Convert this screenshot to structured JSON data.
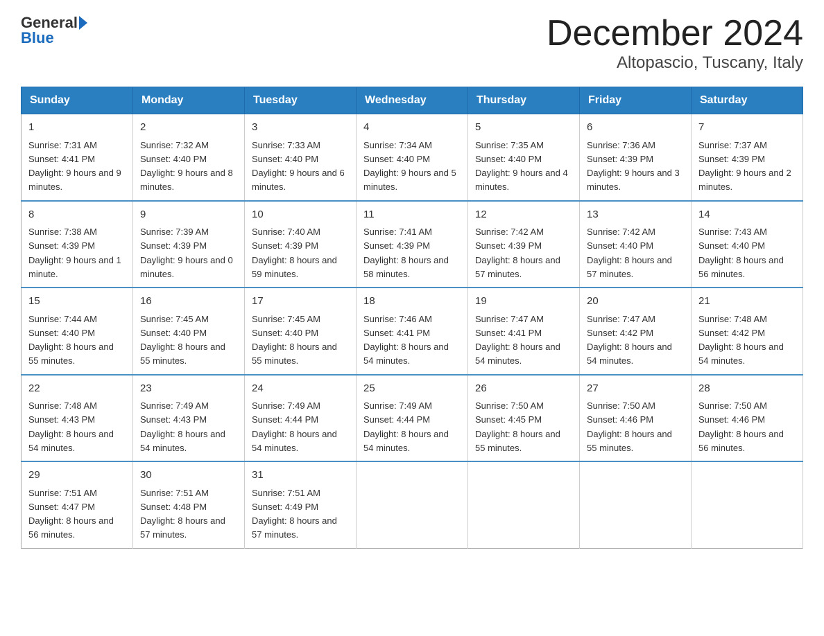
{
  "header": {
    "logo_general": "General",
    "logo_blue": "Blue",
    "month_title": "December 2024",
    "location": "Altopascio, Tuscany, Italy"
  },
  "days_of_week": [
    "Sunday",
    "Monday",
    "Tuesday",
    "Wednesday",
    "Thursday",
    "Friday",
    "Saturday"
  ],
  "weeks": [
    [
      {
        "day": "1",
        "sunrise": "7:31 AM",
        "sunset": "4:41 PM",
        "daylight": "9 hours and 9 minutes."
      },
      {
        "day": "2",
        "sunrise": "7:32 AM",
        "sunset": "4:40 PM",
        "daylight": "9 hours and 8 minutes."
      },
      {
        "day": "3",
        "sunrise": "7:33 AM",
        "sunset": "4:40 PM",
        "daylight": "9 hours and 6 minutes."
      },
      {
        "day": "4",
        "sunrise": "7:34 AM",
        "sunset": "4:40 PM",
        "daylight": "9 hours and 5 minutes."
      },
      {
        "day": "5",
        "sunrise": "7:35 AM",
        "sunset": "4:40 PM",
        "daylight": "9 hours and 4 minutes."
      },
      {
        "day": "6",
        "sunrise": "7:36 AM",
        "sunset": "4:39 PM",
        "daylight": "9 hours and 3 minutes."
      },
      {
        "day": "7",
        "sunrise": "7:37 AM",
        "sunset": "4:39 PM",
        "daylight": "9 hours and 2 minutes."
      }
    ],
    [
      {
        "day": "8",
        "sunrise": "7:38 AM",
        "sunset": "4:39 PM",
        "daylight": "9 hours and 1 minute."
      },
      {
        "day": "9",
        "sunrise": "7:39 AM",
        "sunset": "4:39 PM",
        "daylight": "9 hours and 0 minutes."
      },
      {
        "day": "10",
        "sunrise": "7:40 AM",
        "sunset": "4:39 PM",
        "daylight": "8 hours and 59 minutes."
      },
      {
        "day": "11",
        "sunrise": "7:41 AM",
        "sunset": "4:39 PM",
        "daylight": "8 hours and 58 minutes."
      },
      {
        "day": "12",
        "sunrise": "7:42 AM",
        "sunset": "4:39 PM",
        "daylight": "8 hours and 57 minutes."
      },
      {
        "day": "13",
        "sunrise": "7:42 AM",
        "sunset": "4:40 PM",
        "daylight": "8 hours and 57 minutes."
      },
      {
        "day": "14",
        "sunrise": "7:43 AM",
        "sunset": "4:40 PM",
        "daylight": "8 hours and 56 minutes."
      }
    ],
    [
      {
        "day": "15",
        "sunrise": "7:44 AM",
        "sunset": "4:40 PM",
        "daylight": "8 hours and 55 minutes."
      },
      {
        "day": "16",
        "sunrise": "7:45 AM",
        "sunset": "4:40 PM",
        "daylight": "8 hours and 55 minutes."
      },
      {
        "day": "17",
        "sunrise": "7:45 AM",
        "sunset": "4:40 PM",
        "daylight": "8 hours and 55 minutes."
      },
      {
        "day": "18",
        "sunrise": "7:46 AM",
        "sunset": "4:41 PM",
        "daylight": "8 hours and 54 minutes."
      },
      {
        "day": "19",
        "sunrise": "7:47 AM",
        "sunset": "4:41 PM",
        "daylight": "8 hours and 54 minutes."
      },
      {
        "day": "20",
        "sunrise": "7:47 AM",
        "sunset": "4:42 PM",
        "daylight": "8 hours and 54 minutes."
      },
      {
        "day": "21",
        "sunrise": "7:48 AM",
        "sunset": "4:42 PM",
        "daylight": "8 hours and 54 minutes."
      }
    ],
    [
      {
        "day": "22",
        "sunrise": "7:48 AM",
        "sunset": "4:43 PM",
        "daylight": "8 hours and 54 minutes."
      },
      {
        "day": "23",
        "sunrise": "7:49 AM",
        "sunset": "4:43 PM",
        "daylight": "8 hours and 54 minutes."
      },
      {
        "day": "24",
        "sunrise": "7:49 AM",
        "sunset": "4:44 PM",
        "daylight": "8 hours and 54 minutes."
      },
      {
        "day": "25",
        "sunrise": "7:49 AM",
        "sunset": "4:44 PM",
        "daylight": "8 hours and 54 minutes."
      },
      {
        "day": "26",
        "sunrise": "7:50 AM",
        "sunset": "4:45 PM",
        "daylight": "8 hours and 55 minutes."
      },
      {
        "day": "27",
        "sunrise": "7:50 AM",
        "sunset": "4:46 PM",
        "daylight": "8 hours and 55 minutes."
      },
      {
        "day": "28",
        "sunrise": "7:50 AM",
        "sunset": "4:46 PM",
        "daylight": "8 hours and 56 minutes."
      }
    ],
    [
      {
        "day": "29",
        "sunrise": "7:51 AM",
        "sunset": "4:47 PM",
        "daylight": "8 hours and 56 minutes."
      },
      {
        "day": "30",
        "sunrise": "7:51 AM",
        "sunset": "4:48 PM",
        "daylight": "8 hours and 57 minutes."
      },
      {
        "day": "31",
        "sunrise": "7:51 AM",
        "sunset": "4:49 PM",
        "daylight": "8 hours and 57 minutes."
      },
      null,
      null,
      null,
      null
    ]
  ]
}
